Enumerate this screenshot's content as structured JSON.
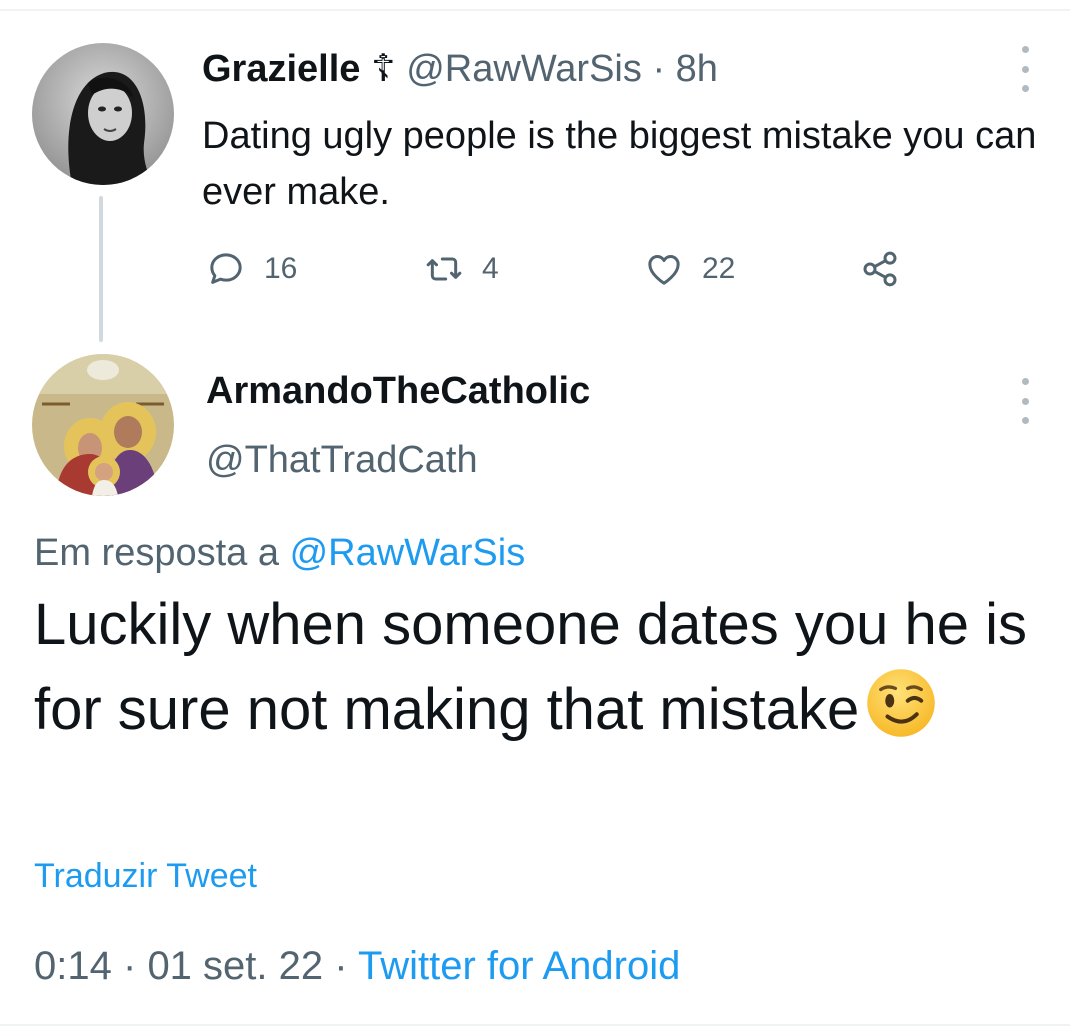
{
  "parent_tweet": {
    "display_name": "Grazielle",
    "name_symbol": "☦",
    "handle": "@RawWarSis",
    "separator": "·",
    "time": "8h",
    "text": "Dating ugly people is the biggest mistake you can ever make.",
    "replies": "16",
    "retweets": "4",
    "likes": "22"
  },
  "reply_tweet": {
    "display_name": "ArmandoTheCatholic",
    "handle": "@ThatTradCath",
    "replying_to_prefix": "Em resposta a",
    "replying_to_handle": "@RawWarSis",
    "text": "Luckily when someone dates you he is for sure not making that mistake",
    "emoji": "winking-face",
    "translate_label": "Traduzir Tweet",
    "time": "0:14",
    "date": "01 set. 22",
    "separator": "·",
    "source": "Twitter for Android"
  },
  "colors": {
    "text": "#0f1419",
    "muted": "#536471",
    "link": "#1d9bf0",
    "thread_line": "#cfd9de"
  }
}
